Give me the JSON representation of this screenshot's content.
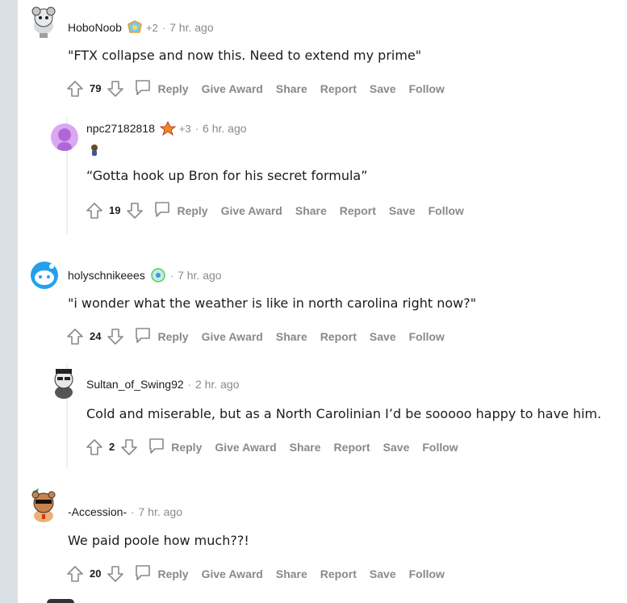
{
  "comments": [
    {
      "author": "HoboNoob",
      "award_count": "+2",
      "separator": "·",
      "time": "7 hr. ago",
      "body": "\"FTX collapse and now this. Need to extend my prime\"",
      "score": "79",
      "actions": [
        "Reply",
        "Give Award",
        "Share",
        "Report",
        "Save",
        "Follow"
      ]
    },
    {
      "author": "npc27182818",
      "award_count": "+3",
      "separator": "·",
      "time": "6 hr. ago",
      "body": "“Gotta hook up Bron for his secret formula”",
      "score": "19",
      "actions": [
        "Reply",
        "Give Award",
        "Share",
        "Report",
        "Save",
        "Follow"
      ]
    },
    {
      "author": "holyschnikeees",
      "separator": "·",
      "time": "7 hr. ago",
      "body": "\"i wonder what the weather is like in north carolina right now?\"",
      "score": "24",
      "actions": [
        "Reply",
        "Give Award",
        "Share",
        "Report",
        "Save",
        "Follow"
      ]
    },
    {
      "author": "Sultan_of_Swing92",
      "separator": "·",
      "time": "2 hr. ago",
      "body": "Cold and miserable, but as a North Carolinian I’d be sooooo happy to have him.",
      "score": "2",
      "actions": [
        "Reply",
        "Give Award",
        "Share",
        "Report",
        "Save",
        "Follow"
      ]
    },
    {
      "author": "-Accession-",
      "separator": "·",
      "time": "7 hr. ago",
      "body": "We paid poole how much??!",
      "score": "20",
      "actions": [
        "Reply",
        "Give Award",
        "Share",
        "Report",
        "Save",
        "Follow"
      ]
    }
  ],
  "colors": {
    "meta_gray": "#878a8c",
    "text": "#1c1c1c",
    "thread_line": "#edeff1",
    "gutter": "#dae0e6"
  },
  "icons": [
    "upvote-icon",
    "downvote-icon",
    "reply-bubble-icon",
    "award-icon",
    "avatar-icon"
  ]
}
